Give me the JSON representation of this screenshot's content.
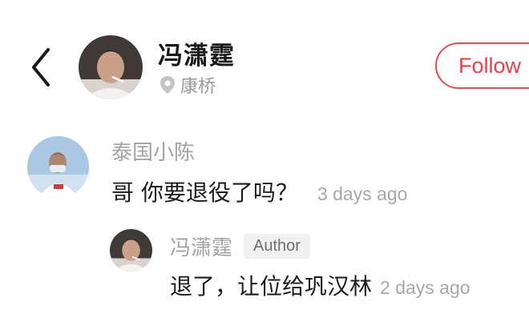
{
  "colors": {
    "accent": "#ef3e4a",
    "muted_text": "#a3a3a3",
    "primary_text": "#1c1c1c",
    "badge_bg": "#f1f1f1"
  },
  "header": {
    "back_icon": "chevron-left-icon",
    "user_name": "冯潇霆",
    "location_icon": "location-pin-icon",
    "location": "康桥",
    "follow_label": "Follow"
  },
  "comment": {
    "author": "泰国小陈",
    "text": "哥 你要退役了吗？",
    "time": "3 days ago"
  },
  "reply": {
    "author": "冯潇霆",
    "badge": "Author",
    "text": "退了，让位给巩汉林",
    "time": "2 days ago"
  }
}
